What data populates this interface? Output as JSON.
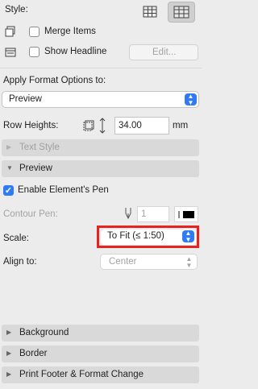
{
  "style_label": "Style:",
  "merge_items": {
    "label": "Merge Items",
    "checked": false
  },
  "show_headline": {
    "label": "Show Headline",
    "checked": false
  },
  "edit_button": "Edit...",
  "apply_format": {
    "label": "Apply Format Options to:",
    "value": "Preview"
  },
  "row_heights": {
    "label": "Row Heights:",
    "value": "34.00",
    "unit": "mm"
  },
  "sections": {
    "text_style": "Text Style",
    "preview": "Preview",
    "background": "Background",
    "border": "Border",
    "print_footer": "Print Footer & Format Change"
  },
  "enable_pen": {
    "label": "Enable Element's Pen",
    "checked": true
  },
  "contour_pen": {
    "label": "Contour Pen:",
    "value": "1"
  },
  "scale": {
    "label": "Scale:",
    "value": "To Fit (≤ 1:50)"
  },
  "align_to": {
    "label": "Align to:",
    "value": "Center"
  },
  "colors": {
    "accent": "#2f7bf5",
    "highlight": "#e8231f",
    "panel": "#ececec"
  }
}
